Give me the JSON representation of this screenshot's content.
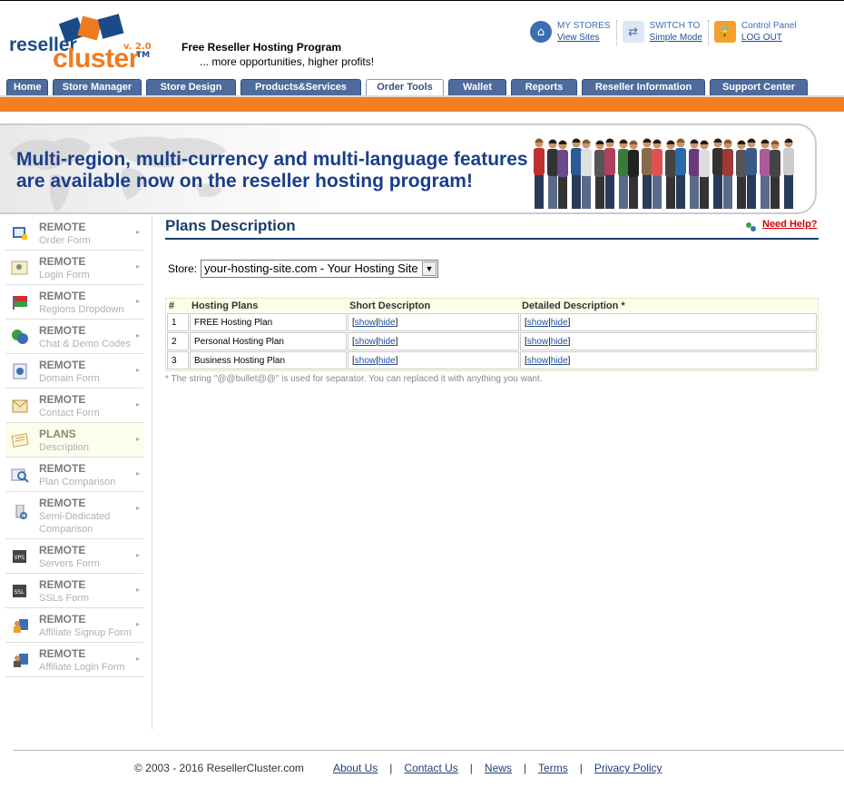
{
  "brand": {
    "logo_word1": "reseller",
    "logo_word2": "cluster",
    "trademark": "TM",
    "version": "v. 2.0",
    "tagline": "Free Reseller Hosting Program",
    "subtagline": "... more opportunities, higher profits!"
  },
  "toplinks": {
    "my_stores_title": "MY STORES",
    "my_stores_link": "View Sites",
    "switch_title": "SWITCH TO",
    "switch_link": "Simple Mode",
    "cp_title": "Control Panel",
    "cp_link": "LOG OUT"
  },
  "nav": {
    "tabs": [
      "Home",
      "Store Manager",
      "Store Design",
      "Products&Services",
      "Order Tools",
      "Wallet",
      "Reports",
      "Reseller Information",
      "Support Center"
    ],
    "active": "Order Tools"
  },
  "banner": {
    "line1": "Multi-region, multi-currency and multi-language features",
    "line2": "are available now on the reseller hosting program!"
  },
  "sidebar": {
    "items": [
      {
        "title": "REMOTE",
        "sub": "Order Form",
        "icon": "order-form-icon"
      },
      {
        "title": "REMOTE",
        "sub": "Login Form",
        "icon": "login-form-icon"
      },
      {
        "title": "REMOTE",
        "sub": "Regions Dropdown",
        "icon": "regions-flag-icon"
      },
      {
        "title": "REMOTE",
        "sub": "Chat & Demo Codes",
        "icon": "chat-icon"
      },
      {
        "title": "REMOTE",
        "sub": "Domain Form",
        "icon": "domain-form-icon"
      },
      {
        "title": "REMOTE",
        "sub": "Contact Form",
        "icon": "contact-form-icon"
      },
      {
        "title": "PLANS",
        "sub": "Description",
        "icon": "plans-description-icon"
      },
      {
        "title": "REMOTE",
        "sub": "Plan Comparison",
        "icon": "plan-comparison-icon"
      },
      {
        "title": "REMOTE",
        "sub": "Semi-Dedicated",
        "sub2": "Comparison",
        "icon": "semi-dedicated-icon"
      },
      {
        "title": "REMOTE",
        "sub": "Servers Form",
        "icon": "vps-icon"
      },
      {
        "title": "REMOTE",
        "sub": "SSLs Form",
        "icon": "ssl-icon"
      },
      {
        "title": "REMOTE",
        "sub": "Affiliate Signup Form",
        "icon": "affiliate-signup-icon"
      },
      {
        "title": "REMOTE",
        "sub": "Affiliate Login Form",
        "icon": "affiliate-login-icon"
      }
    ]
  },
  "main": {
    "title": "Plans Description",
    "need_help": "Need Help?",
    "store_label": "Store:",
    "store_value": "your-hosting-site.com - Your Hosting Site",
    "table": {
      "headers": [
        "#",
        "Hosting Plans",
        "Short Descripton",
        "Detailed Description *"
      ],
      "rows": [
        {
          "num": "1",
          "plan": "FREE Hosting Plan"
        },
        {
          "num": "2",
          "plan": "Personal Hosting Plan"
        },
        {
          "num": "3",
          "plan": "Business Hosting Plan"
        }
      ],
      "show_label": "show",
      "hide_label": "hide",
      "bracket_open": "[",
      "bracket_sep": "|",
      "bracket_close": "]"
    },
    "note": "* The string \"@@bullet@@\" is used for separator. You can replaced it with anything you want."
  },
  "footer": {
    "copyright": "© 2003 - 2016 ResellerCluster.com",
    "links": [
      "About Us",
      "Contact Us",
      "News",
      "Terms",
      "Privacy Policy"
    ],
    "separator": "|"
  },
  "colors": {
    "orange": "#f47d20",
    "nav_blue": "#4e6b9b",
    "title_blue": "#1a3e6a",
    "help_red": "#d40000"
  }
}
